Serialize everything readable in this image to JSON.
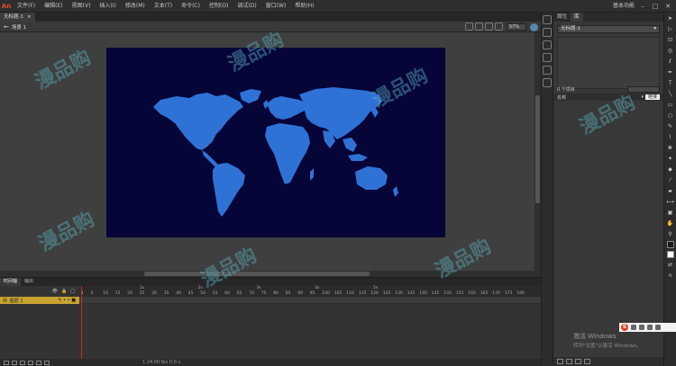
{
  "app": {
    "logo": "An"
  },
  "menu": [
    "文件(F)",
    "编辑(E)",
    "视图(V)",
    "插入(I)",
    "修改(M)",
    "文本(T)",
    "命令(C)",
    "控制(O)",
    "调试(D)",
    "窗口(W)",
    "帮助(H)"
  ],
  "workspace": "基本功能",
  "window_controls": {
    "minimize": "–",
    "maximize": "□",
    "close": "✕"
  },
  "document": {
    "tab_title": "无标题-1",
    "tab_close": "×",
    "scene": "场景 1",
    "zoom": "57%"
  },
  "stage": {
    "background": "#050538",
    "map_color": "#2f72d6"
  },
  "right_panel": {
    "tabs": [
      "属性",
      "库"
    ],
    "library_select": "无标题-1",
    "item_count": "0 个项目",
    "col_name": "名称",
    "col_linkage": "链接"
  },
  "timeline": {
    "tabs": [
      "时间轴",
      "输出"
    ],
    "layer_name": "图层 1",
    "seconds": [
      "1s",
      "2s",
      "3s",
      "4s",
      "5s"
    ],
    "frames": [
      "1",
      "5",
      "10",
      "15",
      "20",
      "25",
      "30",
      "35",
      "40",
      "45",
      "50",
      "55",
      "60",
      "65",
      "70",
      "75",
      "80",
      "85",
      "90",
      "95",
      "100",
      "105",
      "110",
      "115",
      "120",
      "125",
      "130",
      "135",
      "140",
      "145",
      "150",
      "155",
      "160",
      "165",
      "170",
      "175",
      "180"
    ],
    "status": "1 24.00 fps 0.0 s"
  },
  "overlay": {
    "activation_title": "激活 Windows",
    "activation_sub": "转到\"设置\"以激活 Windows。",
    "ime_logo": "S",
    "watermark": "漫品购"
  }
}
